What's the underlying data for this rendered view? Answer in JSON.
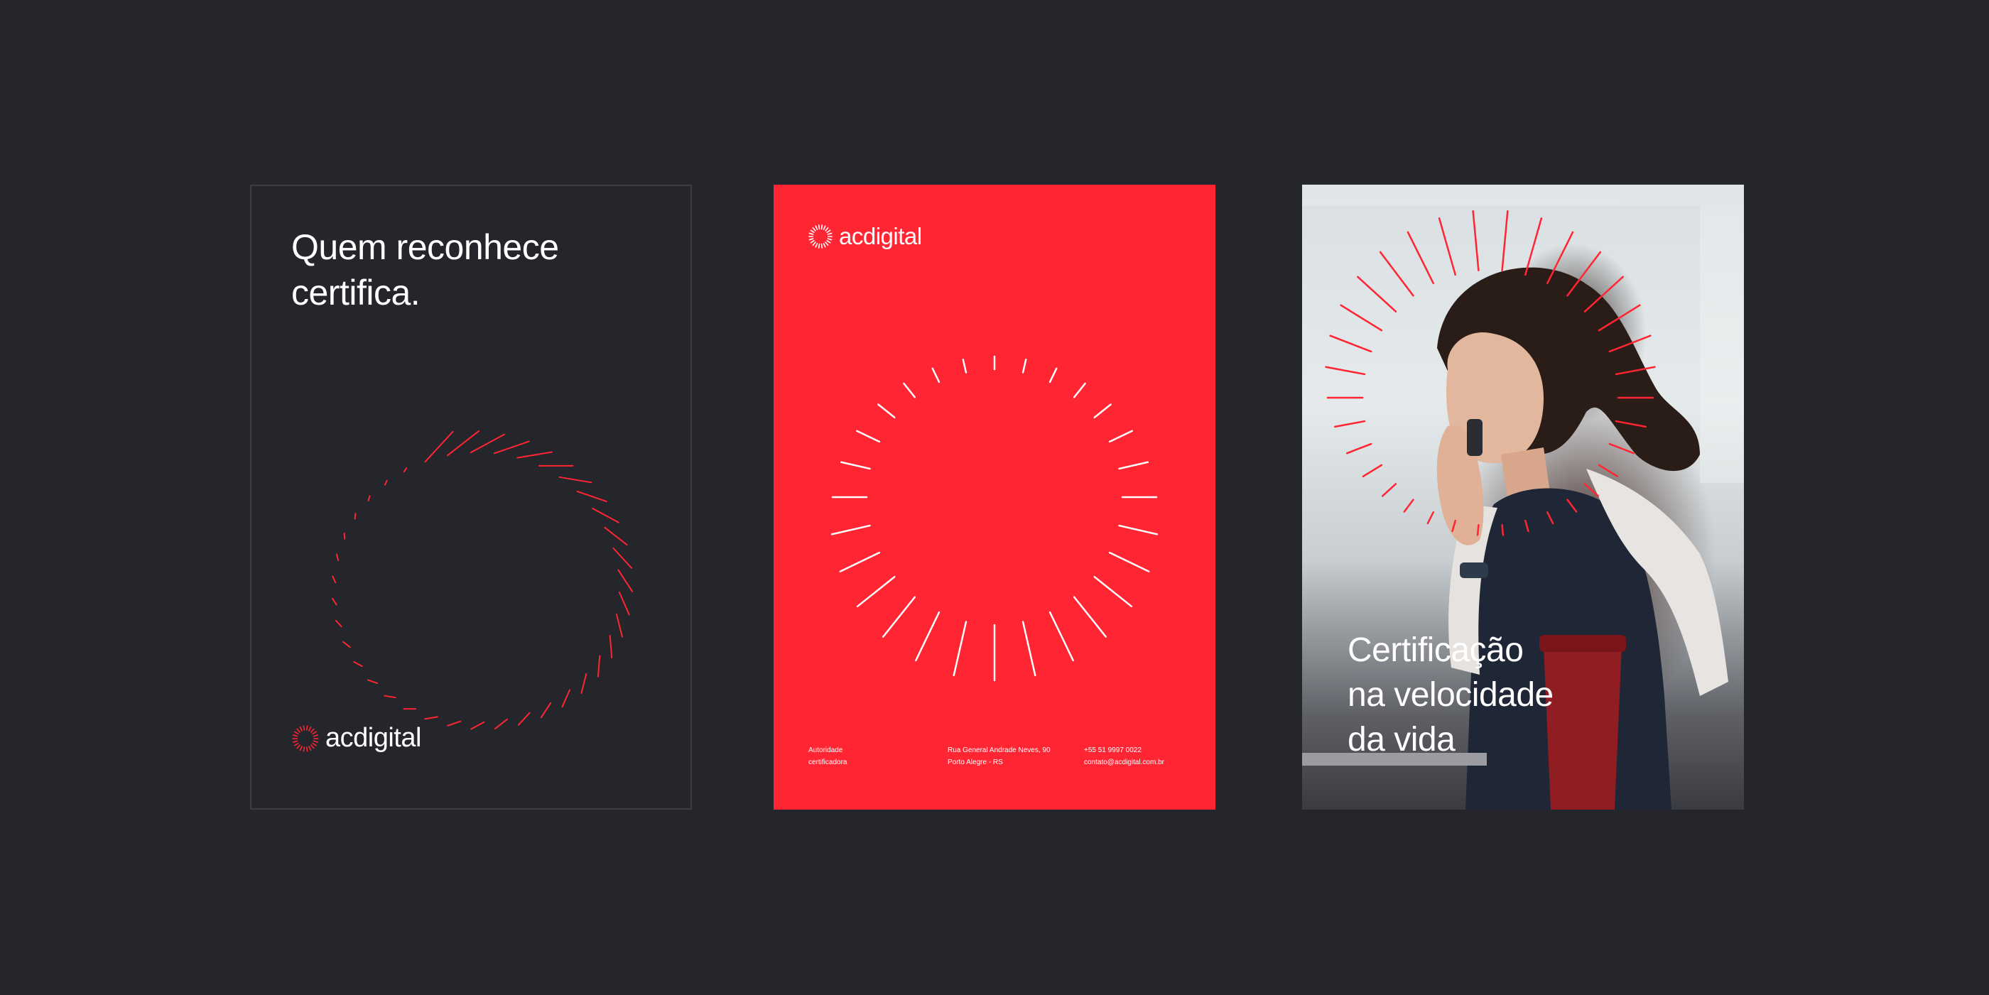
{
  "poster_dark": {
    "headline": [
      "Quem reconhece",
      "certifica."
    ],
    "logo_text": "acdigital"
  },
  "poster_red": {
    "logo_text": "acdigital",
    "footer": {
      "col1": [
        "Autoridade",
        "certificadora"
      ],
      "col2": [
        "Rua General Andrade Neves, 90",
        "Porto Alegre - RS"
      ],
      "col3": [
        "+55 51 9997 0022",
        "contato@acdigital.com.br"
      ]
    }
  },
  "poster_photo": {
    "headline": [
      "Certificação",
      "na velocidade",
      "da vida"
    ]
  },
  "colors": {
    "background": "#25262b",
    "brand_red": "#ff2533",
    "white": "#ffffff"
  }
}
